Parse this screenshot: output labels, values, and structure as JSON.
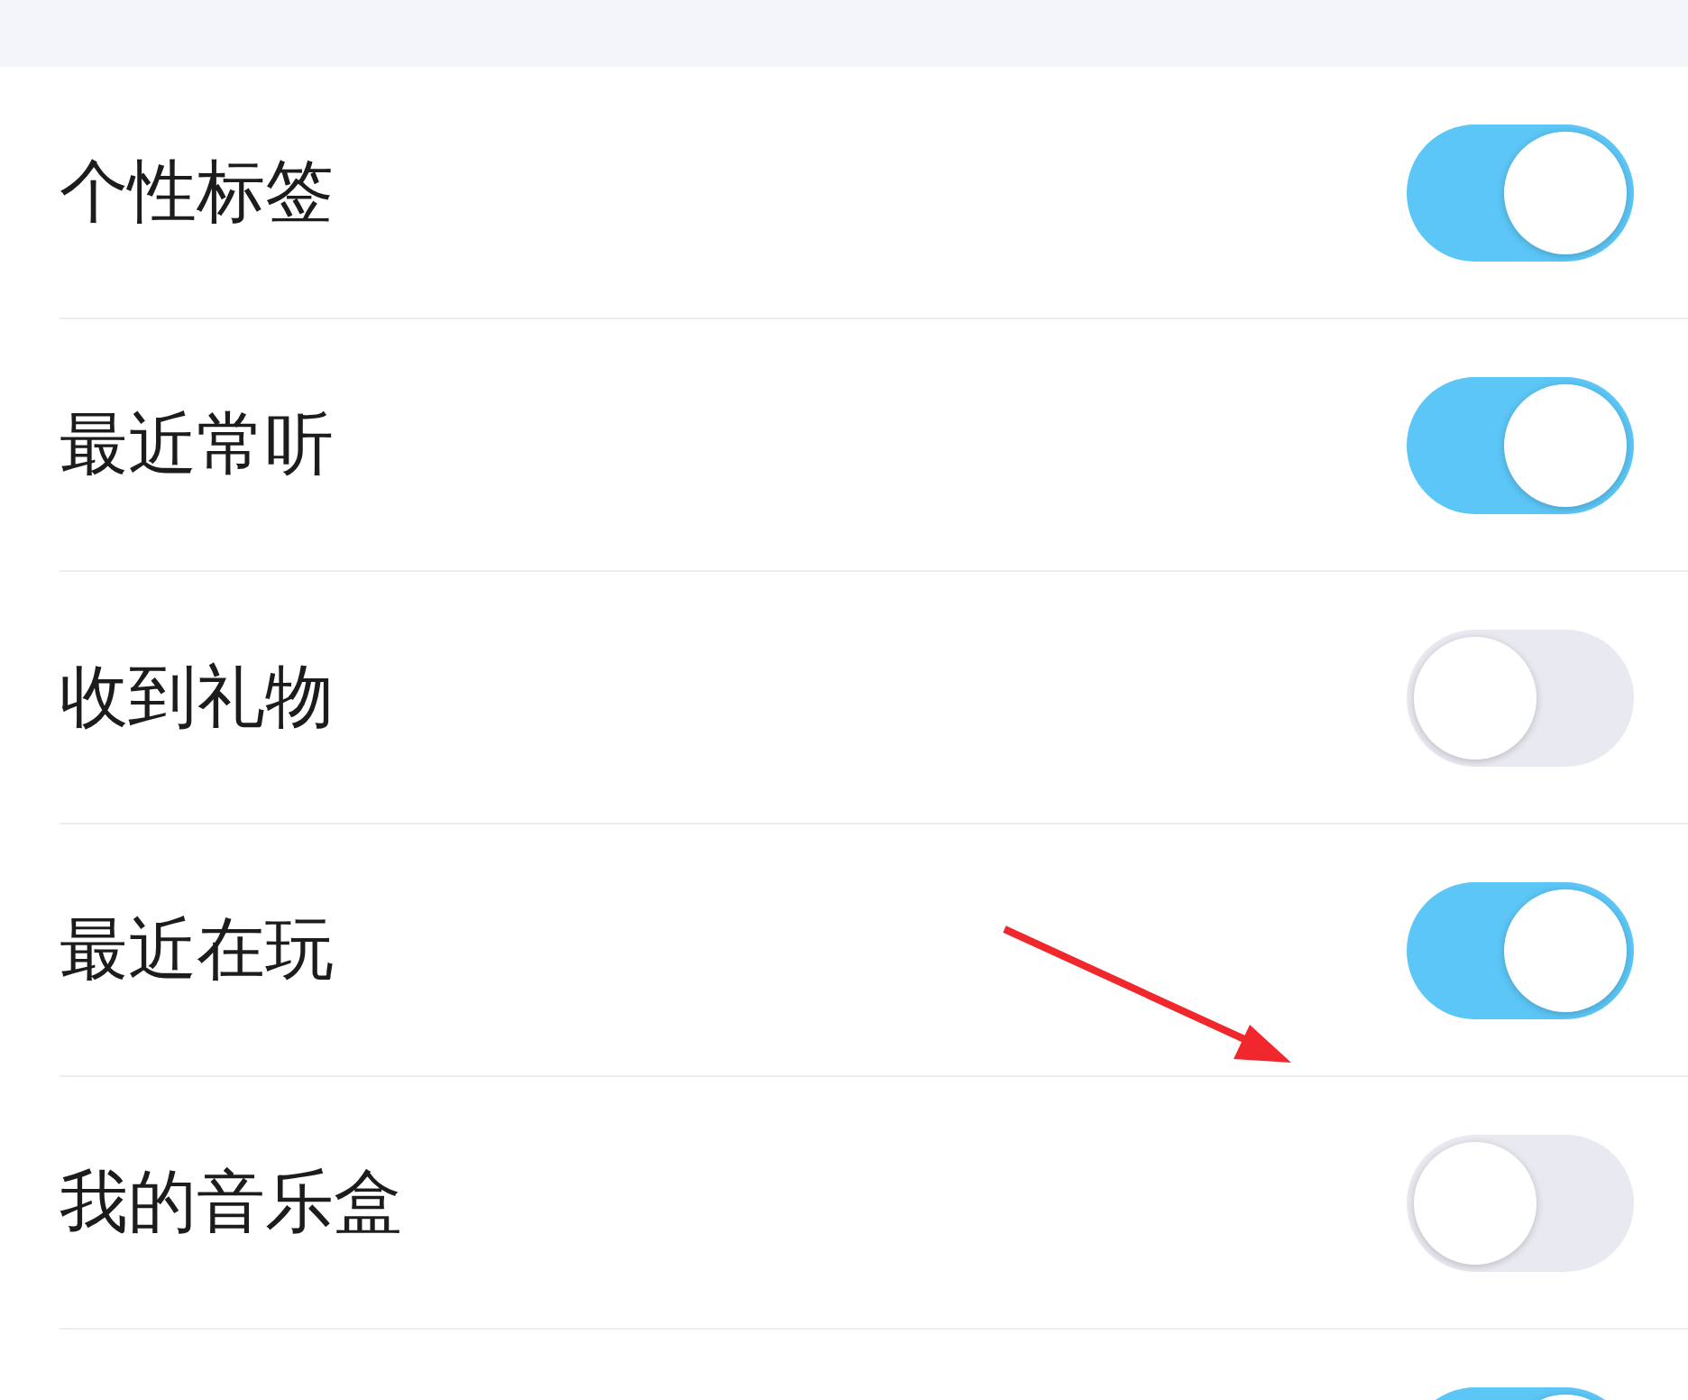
{
  "settings": [
    {
      "label": "个性标签",
      "on": true
    },
    {
      "label": "最近常听",
      "on": true
    },
    {
      "label": "收到礼物",
      "on": false
    },
    {
      "label": "最近在玩",
      "on": true
    },
    {
      "label": "我的音乐盒",
      "on": false
    },
    {
      "on": true
    }
  ]
}
